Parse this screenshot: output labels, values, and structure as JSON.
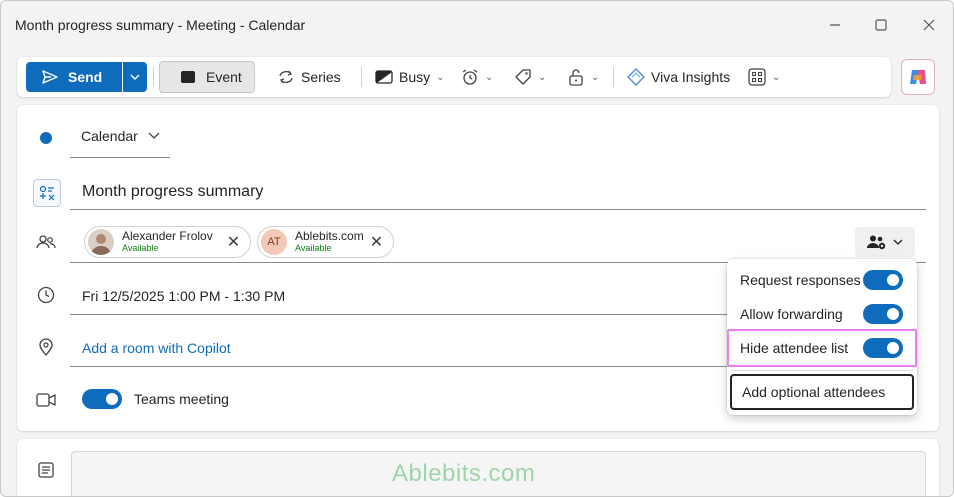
{
  "window": {
    "title": "Month progress summary - Meeting - Calendar",
    "controls": {
      "minimize": "—",
      "maximize": "☐",
      "close": "✕"
    }
  },
  "ribbon": {
    "send_label": "Send",
    "event_label": "Event",
    "series_label": "Series",
    "busy_label": "Busy",
    "viva_label": "Viva Insights"
  },
  "form": {
    "calendar_label": "Calendar",
    "title_value": "Month progress summary",
    "attendees": [
      {
        "name": "Alexander Frolov",
        "status": "Available",
        "initials": "",
        "avatar_color": "#c8b8a8"
      },
      {
        "name": "Ablebits.com",
        "status": "Available",
        "initials": "AT",
        "avatar_color": "#f3c9b5"
      }
    ],
    "datetime": "Fri 12/5/2025 1:00 PM - 1:30 PM",
    "location_link": "Add a room with Copilot",
    "teams_label": "Teams meeting"
  },
  "attendee_options": {
    "items": [
      {
        "label": "Request responses",
        "on": true
      },
      {
        "label": "Allow forwarding",
        "on": true
      },
      {
        "label": "Hide attendee list",
        "on": true
      }
    ],
    "add_optional": "Add optional attendees"
  },
  "body": {
    "watermark": "Ablebits.com"
  },
  "colors": {
    "accent": "#0f6cbd",
    "available": "#107c10",
    "highlight": "#f07ef0"
  }
}
